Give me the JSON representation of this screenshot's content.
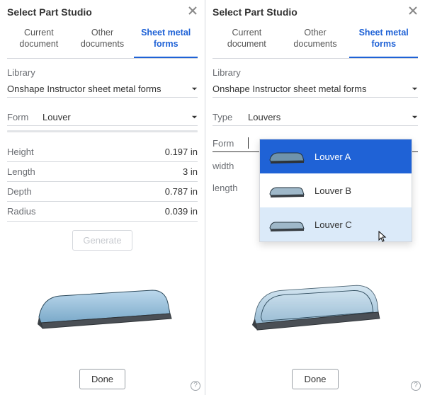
{
  "left": {
    "title": "Select Part Studio",
    "tabs": [
      "Current document",
      "Other documents",
      "Sheet metal forms"
    ],
    "active_tab": 2,
    "library_label": "Library",
    "library_value": "Onshape Instructor sheet metal forms",
    "form_label": "Form",
    "form_value": "Louver",
    "props": [
      {
        "label": "Height",
        "value": "0.197 in"
      },
      {
        "label": "Length",
        "value": "3 in"
      },
      {
        "label": "Depth",
        "value": "0.787 in"
      },
      {
        "label": "Radius",
        "value": "0.039 in"
      }
    ],
    "generate": "Generate",
    "done": "Done"
  },
  "right": {
    "title": "Select Part Studio",
    "tabs": [
      "Current document",
      "Other documents",
      "Sheet metal forms"
    ],
    "active_tab": 2,
    "library_label": "Library",
    "library_value": "Onshape Instructor sheet metal forms",
    "type_label": "Type",
    "type_value": "Louvers",
    "form_label": "Form",
    "form_value": "",
    "side_labels": [
      "width",
      "length"
    ],
    "options": [
      "Louver A",
      "Louver B",
      "Louver C"
    ],
    "selected": 0,
    "hovered": 2,
    "done": "Done"
  },
  "colors": {
    "accent": "#1f62d6"
  }
}
